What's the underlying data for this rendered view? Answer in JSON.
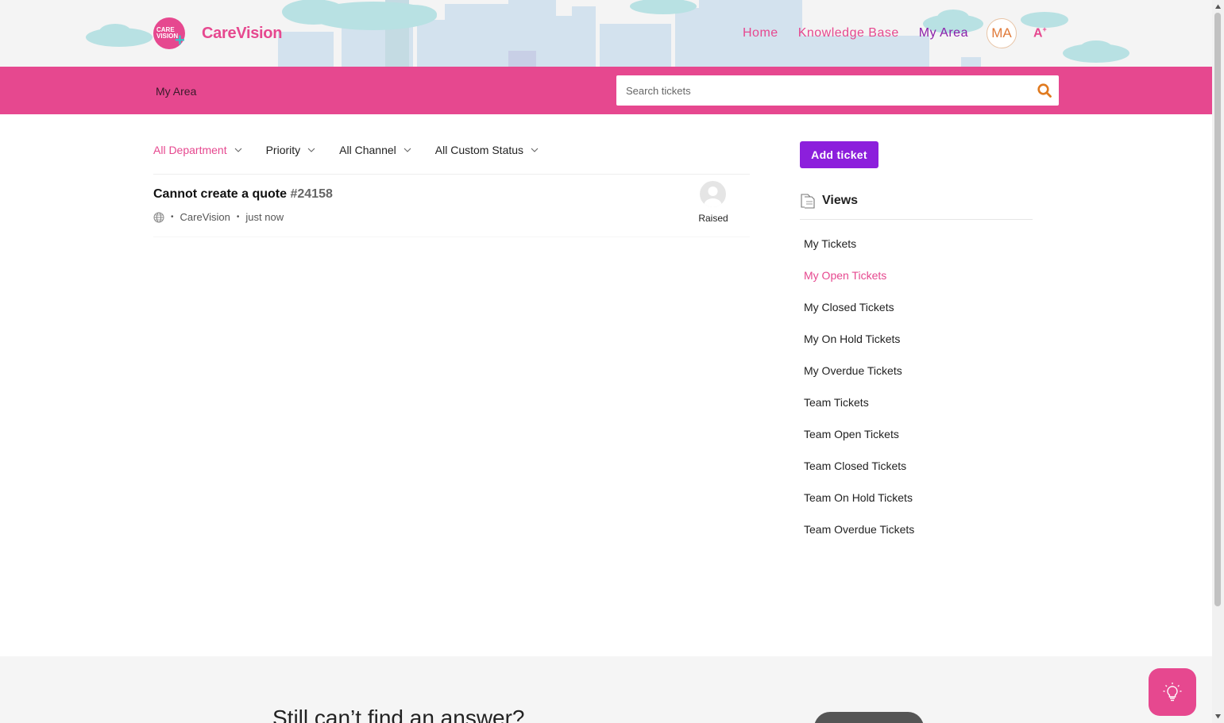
{
  "header": {
    "logo_circle_line1": "CARE",
    "logo_circle_line2": "VISION",
    "logo_text": "CareVision",
    "nav": [
      {
        "label": "Home",
        "active": false
      },
      {
        "label": "Knowledge Base",
        "active": false
      },
      {
        "label": "My Area",
        "active": true
      }
    ],
    "avatar_initials": "MA",
    "font_toggle": "A",
    "font_toggle_sup": "+"
  },
  "subbar": {
    "breadcrumb": "My Area",
    "search_placeholder": "Search tickets",
    "search_icon": "search-icon"
  },
  "filters": [
    {
      "label": "All Department",
      "active": true
    },
    {
      "label": "Priority",
      "active": false
    },
    {
      "label": "All Channel",
      "active": false
    },
    {
      "label": "All Custom Status",
      "active": false
    }
  ],
  "tickets": [
    {
      "title": "Cannot create a quote",
      "id": "#24158",
      "channel_icon": "globe-icon",
      "department": "CareVision",
      "time": "just now",
      "status": "Raised"
    }
  ],
  "sidebar": {
    "add_ticket_label": "Add ticket",
    "views_title": "Views",
    "views": [
      {
        "label": "My Tickets",
        "active": false
      },
      {
        "label": "My Open Tickets",
        "active": true
      },
      {
        "label": "My Closed Tickets",
        "active": false
      },
      {
        "label": "My On Hold Tickets",
        "active": false
      },
      {
        "label": "My Overdue Tickets",
        "active": false
      },
      {
        "label": "Team Tickets",
        "active": false
      },
      {
        "label": "Team Open Tickets",
        "active": false
      },
      {
        "label": "Team Closed Tickets",
        "active": false
      },
      {
        "label": "Team On Hold Tickets",
        "active": false
      },
      {
        "label": "Team Overdue Tickets",
        "active": false
      }
    ]
  },
  "footer": {
    "headline": "Still can’t find an answer?"
  },
  "colors": {
    "brand_pink": "#e6488f",
    "active_purple": "#8c1fa9",
    "button_purple": "#8c1fdc",
    "teal_accent": "#3ac1c8"
  }
}
